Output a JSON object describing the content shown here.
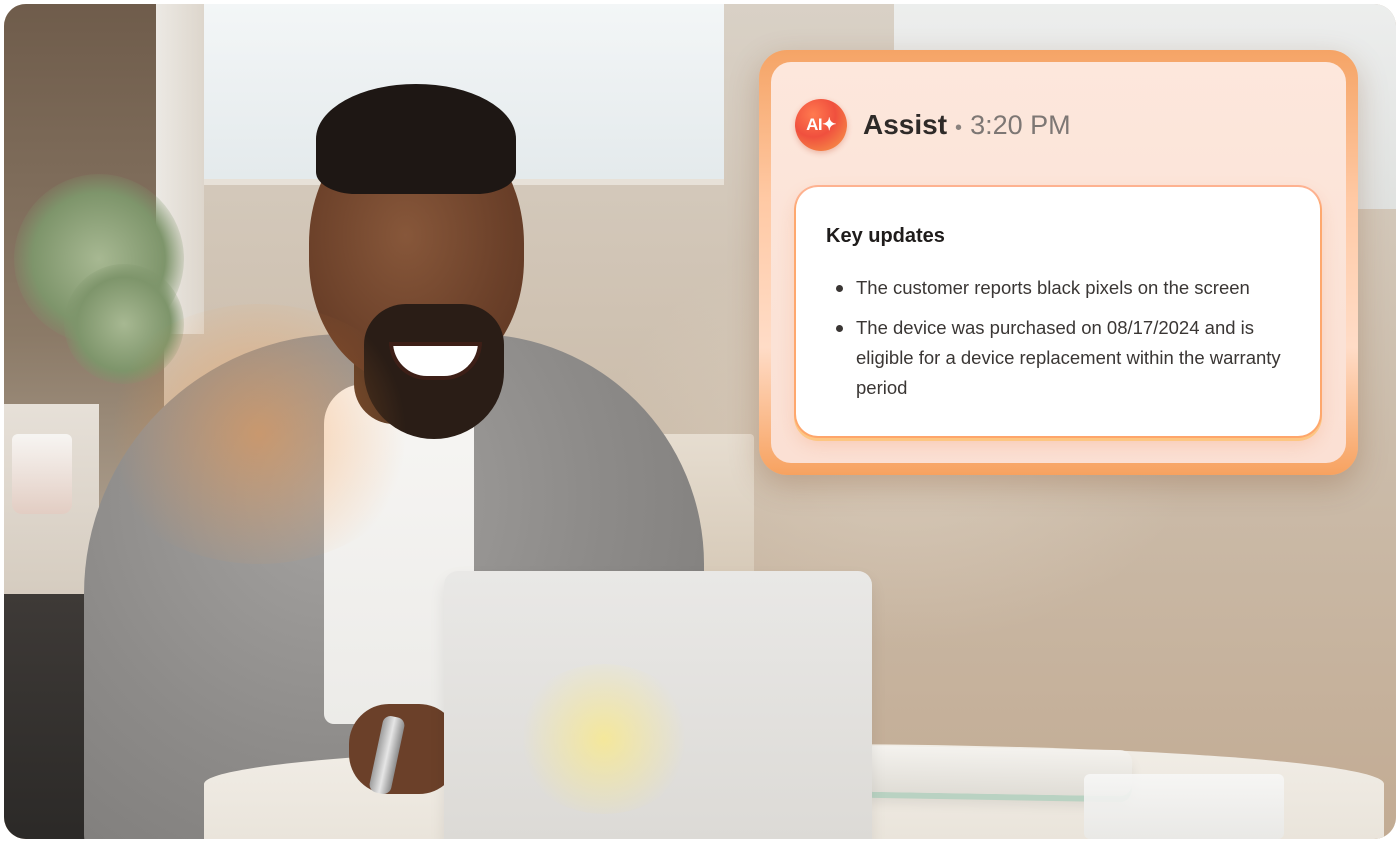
{
  "assist_card": {
    "badge_label": "AI✦",
    "title": "Assist",
    "separator": "•",
    "time": "3:20 PM",
    "section_title": "Key updates",
    "updates": [
      {
        "text": "The customer reports black pixels on the screen"
      },
      {
        "text": "The device was purchased on 08/17/2024 and is eligible for a device replacement within the warranty period"
      }
    ]
  },
  "colors": {
    "card_glow": "#f5a466",
    "badge_gradient_start": "#ff7a4f",
    "badge_gradient_end": "#f8a04a",
    "title_text": "#2e2a28",
    "time_text": "#7d7774"
  }
}
